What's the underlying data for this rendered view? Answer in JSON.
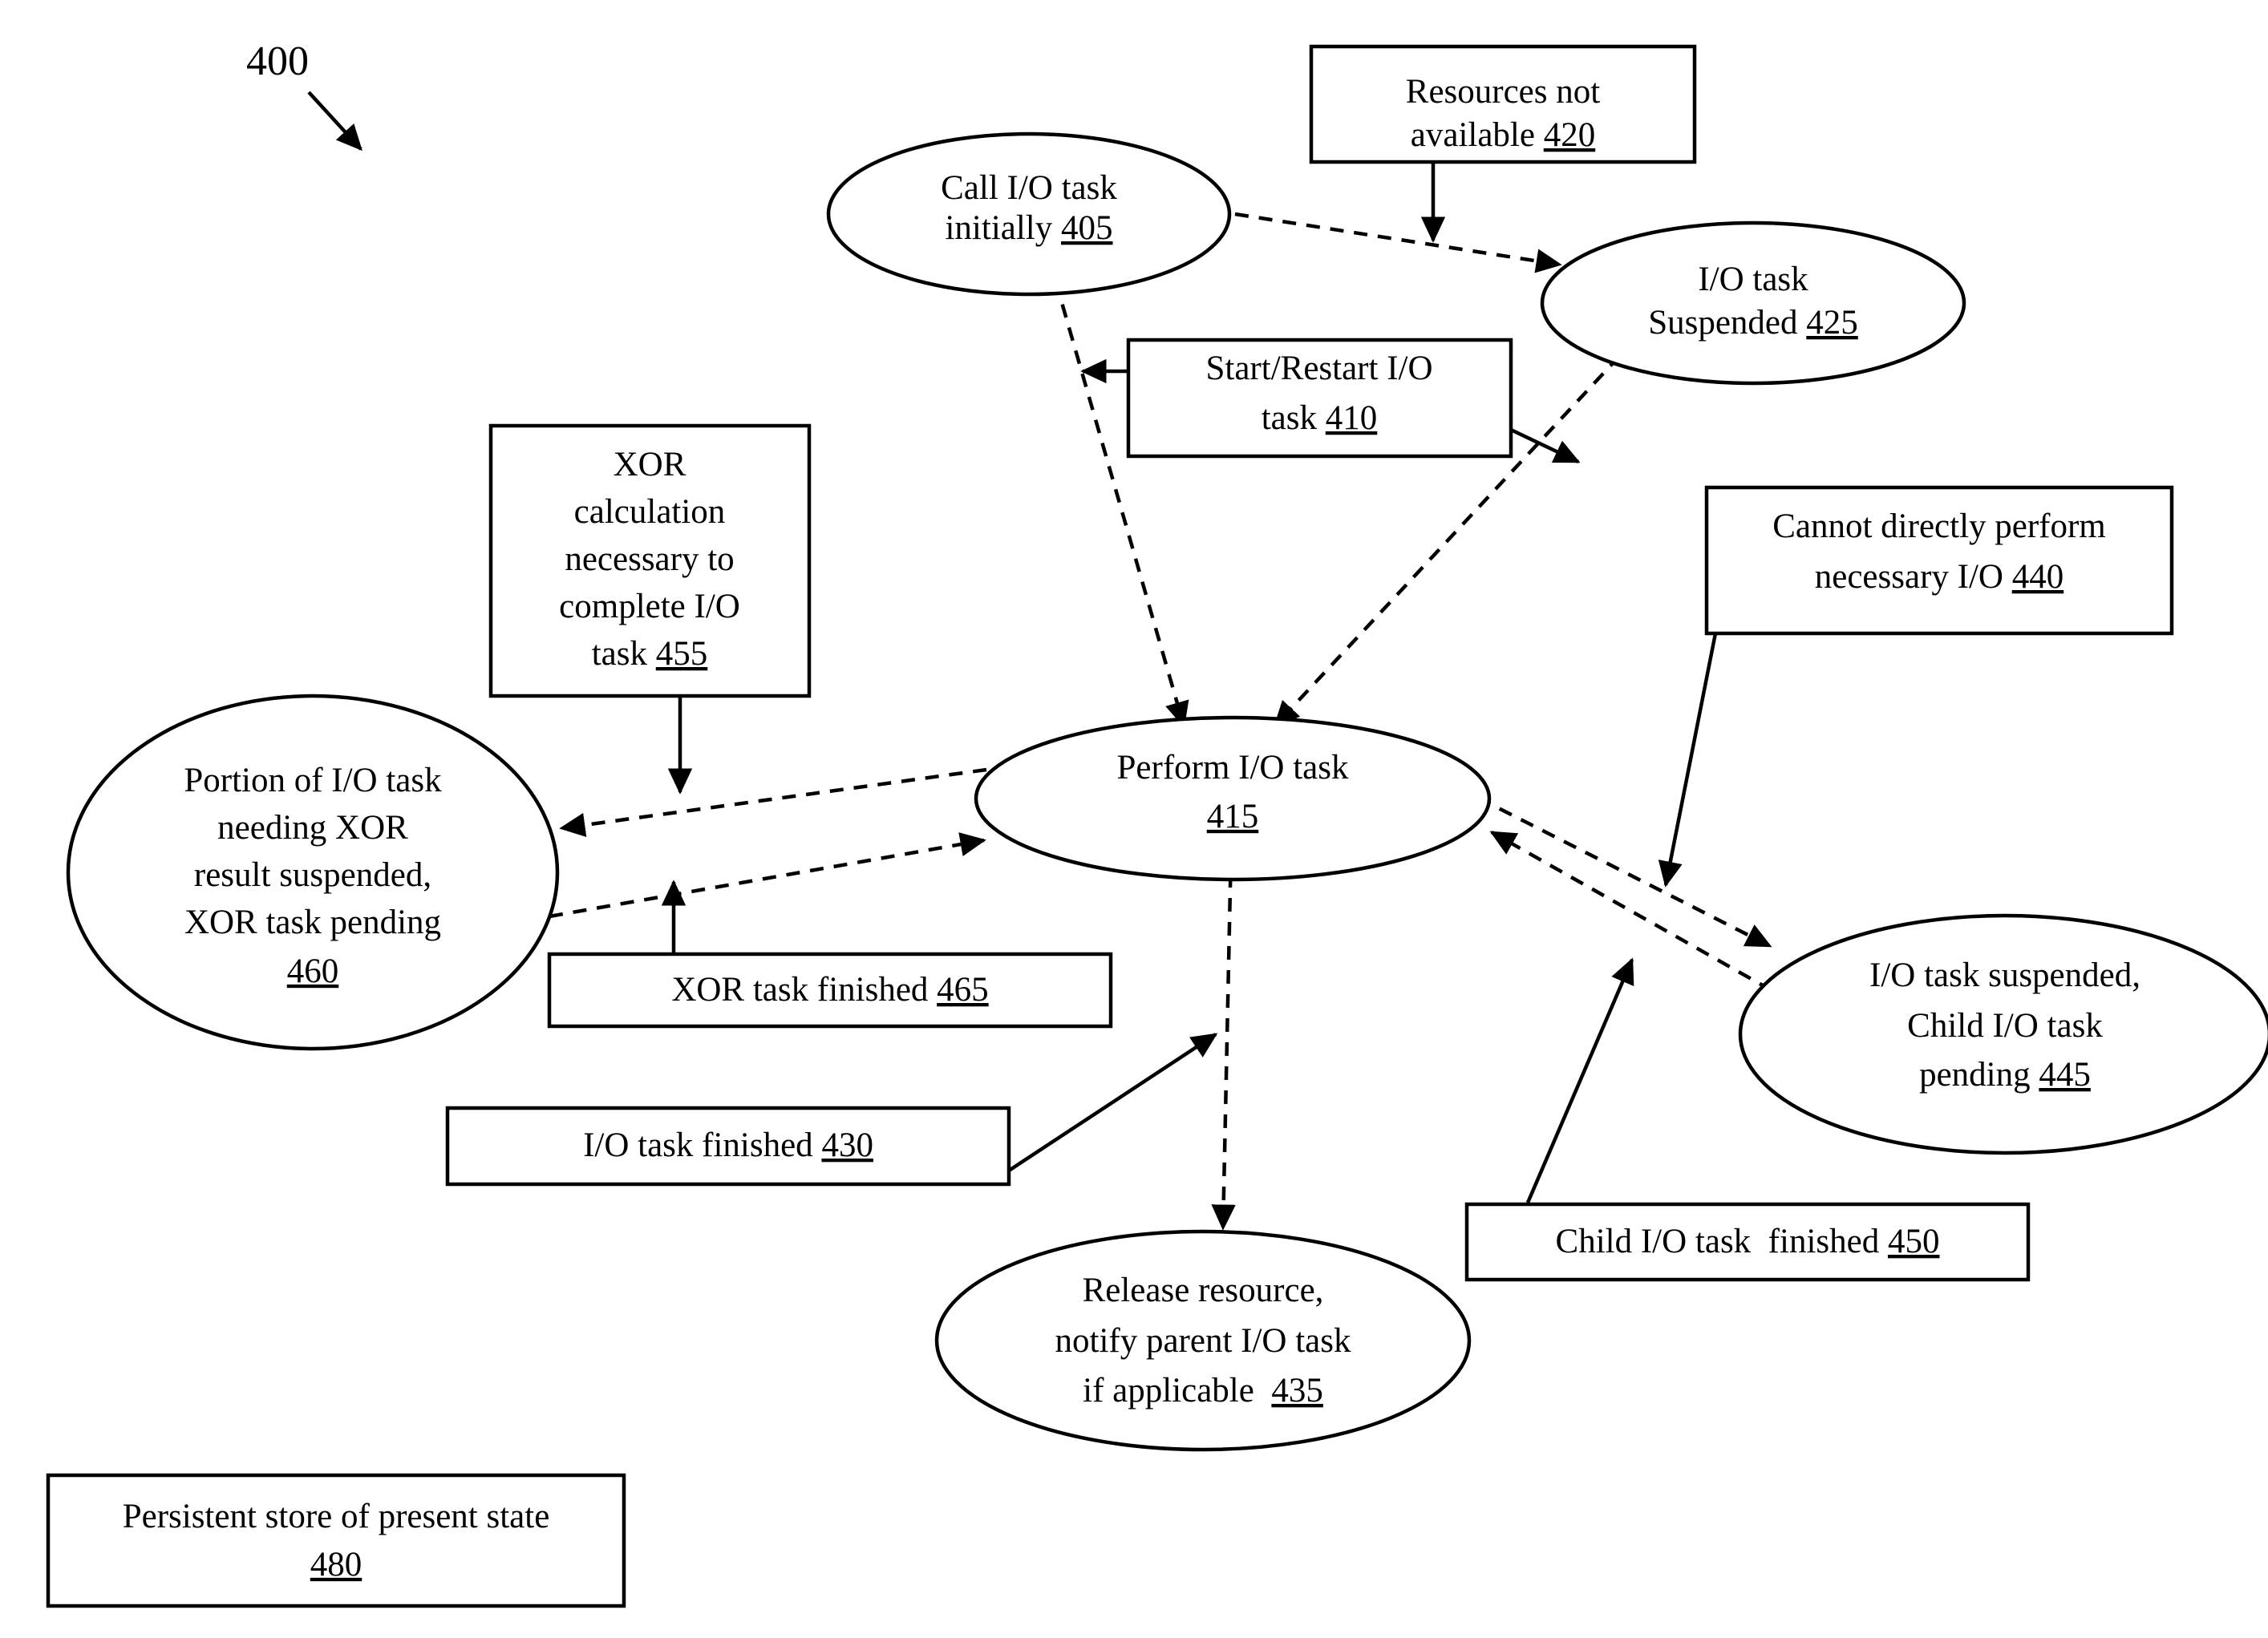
{
  "figure": {
    "label": "400",
    "label_arrow": "diagonal-pointer-arrow"
  },
  "nodes": {
    "n405": {
      "id": "405",
      "shape": "ellipse",
      "lines": [
        "Call I/O task",
        "initially "
      ],
      "line1": "Call I/O task",
      "line2_text": "initially ",
      "line2_ref": "405"
    },
    "n420": {
      "id": "420",
      "shape": "rectangle",
      "line1": "Resources not",
      "line2_text": "available ",
      "line2_ref": "420"
    },
    "n425": {
      "id": "425",
      "shape": "ellipse",
      "line1": "I/O task",
      "line2_text": "Suspended ",
      "line2_ref": "425"
    },
    "n410": {
      "id": "410",
      "shape": "rectangle",
      "line1": "Start/Restart I/O",
      "line2_text": "task ",
      "line2_ref": "410"
    },
    "n455": {
      "id": "455",
      "shape": "rectangle",
      "line1": "XOR",
      "line2": "calculation",
      "line3": "necessary to",
      "line4": "complete I/O",
      "line5_text": "task ",
      "line5_ref": "455"
    },
    "n440": {
      "id": "440",
      "shape": "rectangle",
      "line1": "Cannot directly perform",
      "line2_text": "necessary I/O ",
      "line2_ref": "440"
    },
    "n460": {
      "id": "460",
      "shape": "ellipse",
      "line1": "Portion of I/O task",
      "line2": "needing XOR",
      "line3": "result suspended,",
      "line4": "XOR task pending",
      "line5_ref": "460"
    },
    "n415": {
      "id": "415",
      "shape": "ellipse",
      "line1": "Perform I/O task",
      "line2_ref": "415"
    },
    "n445": {
      "id": "445",
      "shape": "ellipse",
      "line1": "I/O task suspended,",
      "line2": "Child I/O task",
      "line3_text": "pending ",
      "line3_ref": "445"
    },
    "n465": {
      "id": "465",
      "shape": "rectangle",
      "line1_text": "XOR task finished ",
      "line1_ref": "465"
    },
    "n430": {
      "id": "430",
      "shape": "rectangle",
      "line1_text": "I/O task finished ",
      "line1_ref": "430"
    },
    "n450": {
      "id": "450",
      "shape": "rectangle",
      "line1_text": "Child I/O task  finished ",
      "line1_ref": "450"
    },
    "n435": {
      "id": "435",
      "shape": "ellipse",
      "line1": "Release resource,",
      "line2": "notify parent I/O task",
      "line3_text": "if applicable  ",
      "line3_ref": "435"
    },
    "n480": {
      "id": "480",
      "shape": "rectangle",
      "line1": "Persistent store of present state",
      "line2_ref": "480"
    }
  },
  "edges": [
    {
      "name": "call-to-suspended",
      "from": "405",
      "to": "425",
      "style": "dashed"
    },
    {
      "name": "resources-not-available-to-transition",
      "from": "420",
      "to": "405-425-transition",
      "style": "solid"
    },
    {
      "name": "call-to-perform",
      "from": "405",
      "to": "415",
      "style": "dashed"
    },
    {
      "name": "suspended-to-perform",
      "from": "425",
      "to": "415",
      "style": "dashed"
    },
    {
      "name": "start-restart-to-call-perform",
      "from": "410",
      "to": "405-415-transition",
      "style": "solid"
    },
    {
      "name": "start-restart-to-suspended-perform",
      "from": "410",
      "to": "425-415-transition",
      "style": "solid"
    },
    {
      "name": "perform-to-xor-pending",
      "from": "415",
      "to": "460",
      "style": "dashed"
    },
    {
      "name": "xor-pending-to-perform",
      "from": "460",
      "to": "415",
      "style": "dashed"
    },
    {
      "name": "xor-calc-to-perform-xor-pending",
      "from": "455",
      "to": "415-460-transition",
      "style": "solid"
    },
    {
      "name": "xor-finished-to-xor-pending-perform",
      "from": "465",
      "to": "460-415-transition",
      "style": "solid"
    },
    {
      "name": "perform-to-child-pending",
      "from": "415",
      "to": "445",
      "style": "dashed"
    },
    {
      "name": "child-pending-to-perform",
      "from": "445",
      "to": "415",
      "style": "dashed"
    },
    {
      "name": "cannot-perform-to-perform-child",
      "from": "440",
      "to": "415-445-transition",
      "style": "solid"
    },
    {
      "name": "child-finished-to-child-perform",
      "from": "450",
      "to": "445-415-transition",
      "style": "solid"
    },
    {
      "name": "perform-to-release",
      "from": "415",
      "to": "435",
      "style": "dashed"
    },
    {
      "name": "io-finished-to-perform-release",
      "from": "430",
      "to": "415-435-transition",
      "style": "solid"
    }
  ],
  "colors": {
    "stroke": "#000000",
    "fill": "#ffffff",
    "text": "#000000"
  }
}
